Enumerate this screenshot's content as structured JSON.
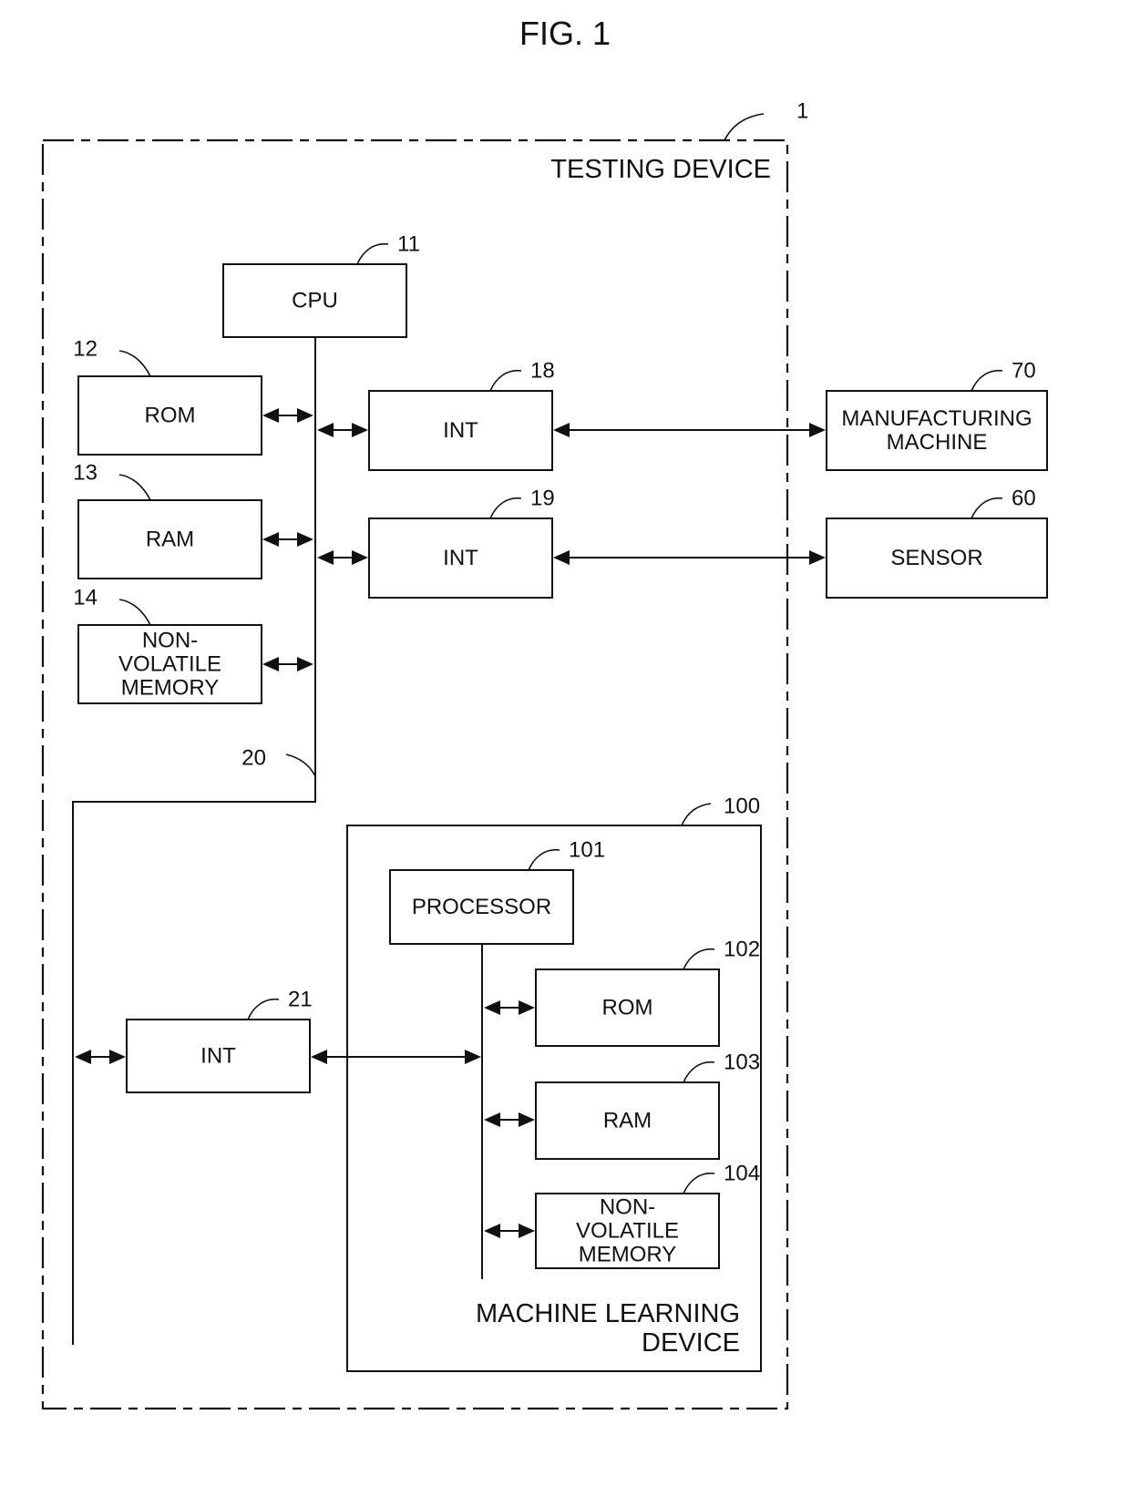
{
  "figure": {
    "title": "FIG. 1"
  },
  "testing_device": {
    "label": "TESTING DEVICE",
    "ref": "1",
    "bus_ref": "20",
    "components": {
      "cpu": {
        "label": [
          "CPU"
        ],
        "ref": "11"
      },
      "rom": {
        "label": [
          "ROM"
        ],
        "ref": "12"
      },
      "ram": {
        "label": [
          "RAM"
        ],
        "ref": "13"
      },
      "nvm": {
        "label": [
          "NON-",
          "VOLATILE",
          "MEMORY"
        ],
        "ref": "14"
      },
      "int18": {
        "label": [
          "INT"
        ],
        "ref": "18"
      },
      "int19": {
        "label": [
          "INT"
        ],
        "ref": "19"
      },
      "int21": {
        "label": [
          "INT"
        ],
        "ref": "21"
      }
    }
  },
  "external": {
    "manufacturing_machine": {
      "label": [
        "MANUFACTURING",
        "MACHINE"
      ],
      "ref": "70"
    },
    "sensor": {
      "label": [
        "SENSOR"
      ],
      "ref": "60"
    }
  },
  "machine_learning_device": {
    "label": [
      "MACHINE LEARNING",
      "DEVICE"
    ],
    "ref": "100",
    "components": {
      "processor": {
        "label": [
          "PROCESSOR"
        ],
        "ref": "101"
      },
      "rom": {
        "label": [
          "ROM"
        ],
        "ref": "102"
      },
      "ram": {
        "label": [
          "RAM"
        ],
        "ref": "103"
      },
      "nvm": {
        "label": [
          "NON-",
          "VOLATILE",
          "MEMORY"
        ],
        "ref": "104"
      }
    }
  },
  "connections": [
    {
      "from": "rom",
      "to": "bus-20",
      "type": "bidirectional"
    },
    {
      "from": "ram",
      "to": "bus-20",
      "type": "bidirectional"
    },
    {
      "from": "nvm",
      "to": "bus-20",
      "type": "bidirectional"
    },
    {
      "from": "bus-20",
      "to": "int18",
      "type": "bidirectional"
    },
    {
      "from": "bus-20",
      "to": "int19",
      "type": "bidirectional"
    },
    {
      "from": "int18",
      "to": "manufacturing_machine",
      "type": "bidirectional"
    },
    {
      "from": "int19",
      "to": "sensor",
      "type": "bidirectional"
    },
    {
      "from": "bus-20",
      "to": "int21",
      "type": "bidirectional"
    },
    {
      "from": "int21",
      "to": "ml-bus",
      "type": "bidirectional"
    },
    {
      "from": "ml-bus",
      "to": "ml-rom",
      "type": "bidirectional"
    },
    {
      "from": "ml-bus",
      "to": "ml-ram",
      "type": "bidirectional"
    },
    {
      "from": "ml-bus",
      "to": "ml-nvm",
      "type": "bidirectional"
    }
  ]
}
